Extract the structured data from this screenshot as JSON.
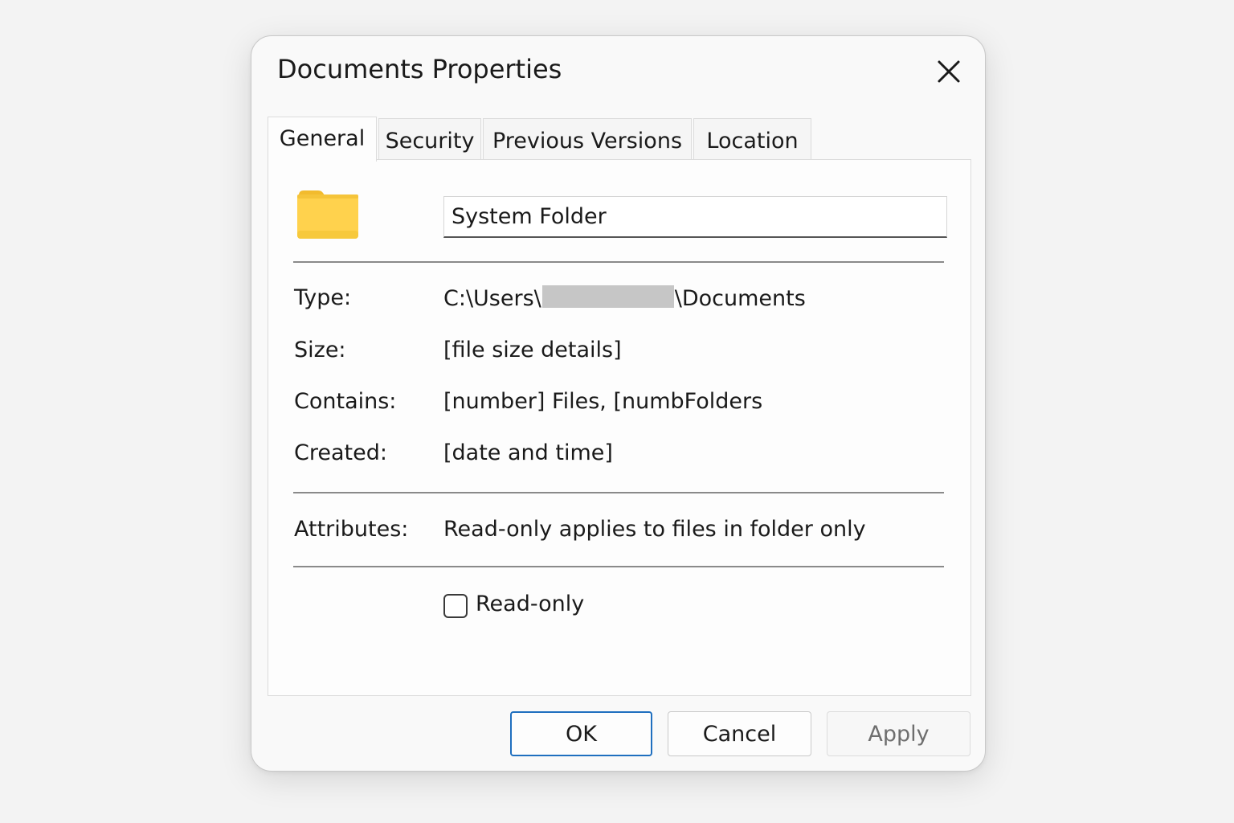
{
  "dialog": {
    "title": "Documents Properties"
  },
  "tabs": [
    {
      "label": "General",
      "active": true
    },
    {
      "label": "Security",
      "active": false
    },
    {
      "label": "Previous Versions",
      "active": false
    },
    {
      "label": "Location",
      "active": false
    }
  ],
  "general": {
    "name_value": "System Folder",
    "type_label": "Type:",
    "type_value_prefix": "C:\\Users\\",
    "type_value_suffix": "\\Documents",
    "size_label": "Size:",
    "size_value": "[file size details]",
    "contains_label": "Contains:",
    "contains_value_a": "[number] Files, [numb",
    "contains_value_b": "Folders",
    "created_label": "Created:",
    "created_value": "[date and time]",
    "attributes_label": "Attributes:",
    "attributes_value": "Read-only applies to files in folder only",
    "readonly_label": "Read-only",
    "readonly_checked": false
  },
  "buttons": {
    "ok": "OK",
    "cancel": "Cancel",
    "apply": "Apply"
  },
  "icons": {
    "close": "close-icon",
    "folder": "folder-icon"
  },
  "colors": {
    "accent": "#1f6fbf",
    "folder_yellow": "#ffd24d"
  }
}
